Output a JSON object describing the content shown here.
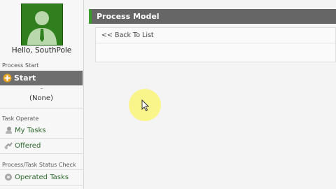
{
  "user": {
    "greeting": "Hello, SouthPole"
  },
  "sidebar": {
    "process_start_label": "Process Start",
    "start_button": "Start",
    "none_item": "(None)",
    "task_operate_label": "Task Operate",
    "my_tasks": "My Tasks",
    "offered": "Offered",
    "status_check_label": "Process/Task Status Check",
    "operated_tasks": "Operated Tasks"
  },
  "main": {
    "title": "Process Model",
    "back_link": "<< Back To List"
  },
  "colors": {
    "accent_green": "#3b9a2c",
    "header_gray": "#666666",
    "link_green": "#2e6b2e"
  },
  "icons": [
    "user-avatar-icon",
    "start-plus-icon",
    "my-tasks-icon",
    "offered-icon",
    "operated-tasks-icon",
    "mouse-cursor-icon"
  ]
}
